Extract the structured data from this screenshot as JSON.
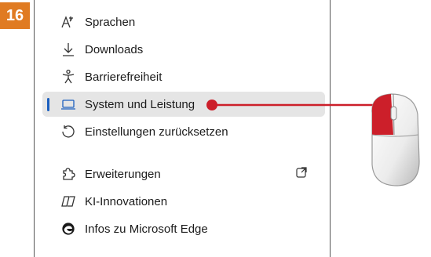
{
  "step": {
    "number": "16",
    "color": "#e07b22"
  },
  "accent": "#1b5fbf",
  "pointer_color": "#cc1f2a",
  "menu": {
    "items": [
      {
        "label": "Sprachen",
        "icon": "language-icon"
      },
      {
        "label": "Downloads",
        "icon": "download-icon"
      },
      {
        "label": "Barrierefreiheit",
        "icon": "accessibility-icon"
      },
      {
        "label": "System und Leistung",
        "icon": "laptop-icon",
        "selected": true
      },
      {
        "label": "Einstellungen zurücksetzen",
        "icon": "reset-icon"
      },
      {
        "label": "Erweiterungen",
        "icon": "puzzle-icon",
        "trailing_icon": "open-external-icon"
      },
      {
        "label": "KI-Innovationen",
        "icon": "copilot-icon"
      },
      {
        "label": "Infos zu Microsoft Edge",
        "icon": "edge-logo-icon"
      }
    ]
  }
}
